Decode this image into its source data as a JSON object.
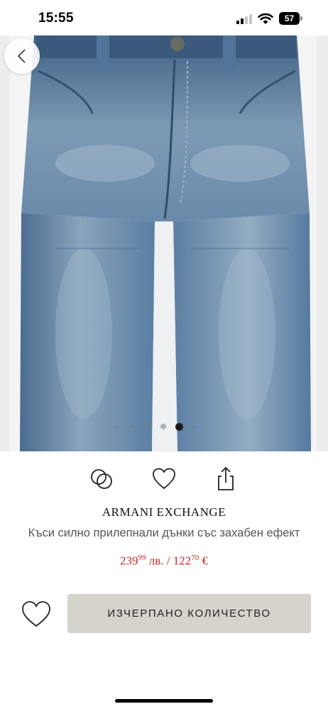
{
  "status_bar": {
    "time": "15:55",
    "battery": "57"
  },
  "product": {
    "brand": "ARMANI EXCHANGE",
    "title": "Къси силно прилепнали дънки със захабен ефект",
    "price_bgn": {
      "main": "239",
      "cents": "99",
      "currency": "лв."
    },
    "price_separator": "/",
    "price_eur": {
      "main": "122",
      "cents": "70",
      "currency": "€"
    },
    "cta_label": "ИЗЧЕРПАНО КОЛИЧЕСТВО"
  },
  "carousel": {
    "total": 6,
    "active_index": 4
  },
  "icons": {
    "back": "chevron-left-icon",
    "compare": "compare-circles-icon",
    "wishlist": "heart-icon",
    "share": "share-icon"
  },
  "colors": {
    "price": "#c62828",
    "cta_bg": "#d6d2cc",
    "denim": "#5b7c9e"
  }
}
